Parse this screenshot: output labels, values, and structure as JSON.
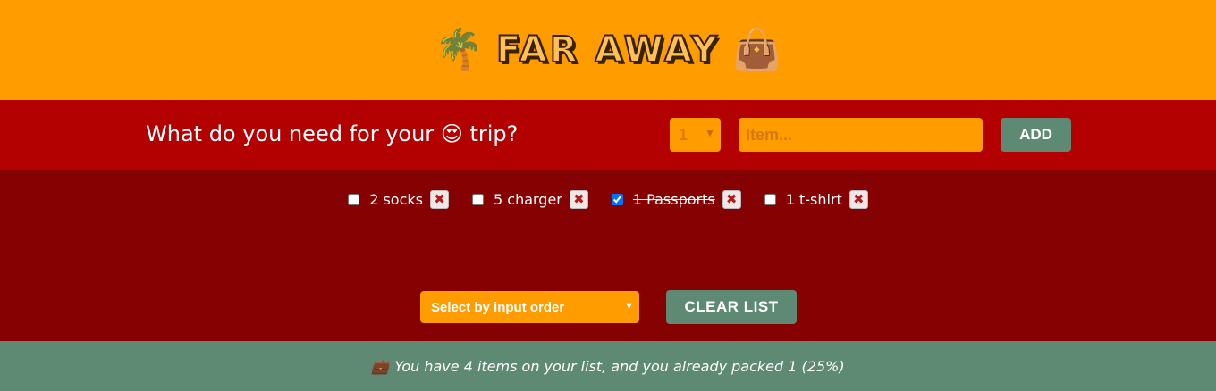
{
  "header": {
    "emoji_left": "🌴",
    "title": "FAR AWAY",
    "emoji_right": "👜"
  },
  "form": {
    "question_prefix": "What do you need for your",
    "question_emoji": "😍",
    "question_suffix": "trip?",
    "quantity_value": "1",
    "item_placeholder": "Item...",
    "add_label": "ADD"
  },
  "items": [
    {
      "label": "2 socks",
      "packed": false
    },
    {
      "label": "5 charger",
      "packed": false
    },
    {
      "label": "1 Passports",
      "packed": true
    },
    {
      "label": "1 t-shirt",
      "packed": false
    }
  ],
  "delete_glyph": "✖",
  "actions": {
    "sort_value": "Select by input order",
    "clear_label": "CLEAR LIST"
  },
  "stats": {
    "emoji": "💼",
    "text": "You have 4 items on your list, and you already packed 1 (25%)"
  },
  "colors": {
    "header_bg": "#ff9c00",
    "form_bg": "#b30000",
    "list_bg": "#860101",
    "button_bg": "#5e8a73",
    "stats_bg": "#5e8a73"
  }
}
